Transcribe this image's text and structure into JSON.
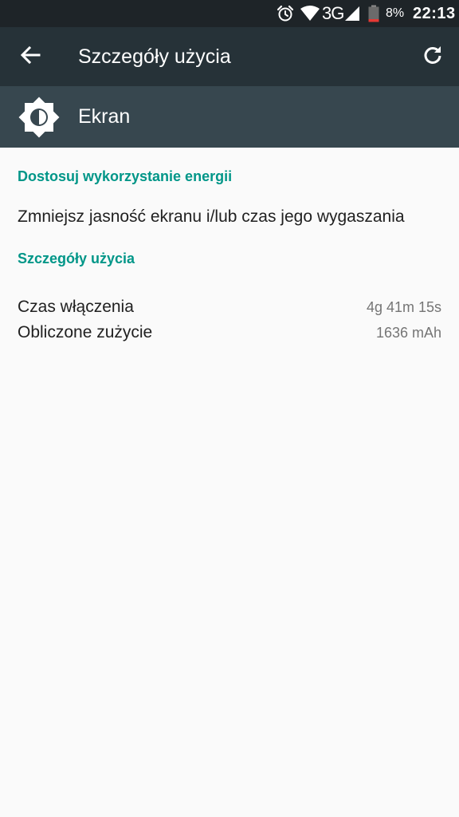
{
  "status_bar": {
    "icons": [
      "alarm-icon",
      "wifi-icon",
      "signal-icon",
      "battery-icon"
    ],
    "network": "3G",
    "battery_percent": "8%",
    "time": "22:13"
  },
  "app_bar": {
    "title": "Szczegóły użycia",
    "back_icon": "arrow-back-icon",
    "refresh_icon": "refresh-icon"
  },
  "app_header": {
    "icon": "brightness-icon",
    "name": "Ekran"
  },
  "sections": {
    "adjust_title": "Dostosuj wykorzystanie energii",
    "adjust_item": "Zmniejsz jasność ekranu i/lub czas jego wygaszania",
    "details_title": "Szczegóły użycia"
  },
  "details": [
    {
      "label": "Czas włączenia",
      "value": "4g 41m 15s"
    },
    {
      "label": "Obliczone zużycie",
      "value": "1636 mAh"
    }
  ],
  "colors": {
    "statusbar": "#1e2428",
    "appbar": "#263238",
    "header": "#37474f",
    "accent": "#009688",
    "background": "#fafafa"
  }
}
